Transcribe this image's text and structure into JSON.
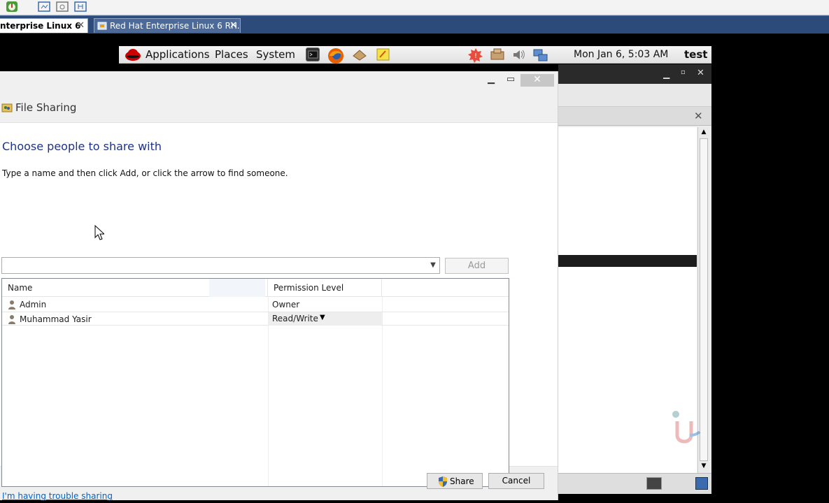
{
  "host": {
    "tabs": [
      {
        "label": "nterprise Linux 6"
      },
      {
        "label": "Red Hat Enterprise Linux 6 RH..."
      }
    ]
  },
  "panel": {
    "menus": [
      "Applications",
      "Places",
      "System"
    ],
    "clock": "Mon Jan  6,  5:03 AM",
    "user": "test"
  },
  "dialog": {
    "title": "File Sharing",
    "heading": "Choose people to share with",
    "instruction": "Type a name and then click Add, or click the arrow to find someone.",
    "combo_value": "",
    "add_label": "Add",
    "columns": [
      "Name",
      "Permission Level"
    ],
    "rows": [
      {
        "name": "Admin",
        "permission": "Owner"
      },
      {
        "name": "Muhammad Yasir",
        "permission": "Read/Write"
      }
    ],
    "help_link": "I'm having trouble sharing",
    "share_label": "Share",
    "cancel_label": "Cancel"
  },
  "colors": {
    "heading": "#1e3287",
    "link": "#0066cc",
    "host_tab_bar": "#2d4b7a"
  }
}
